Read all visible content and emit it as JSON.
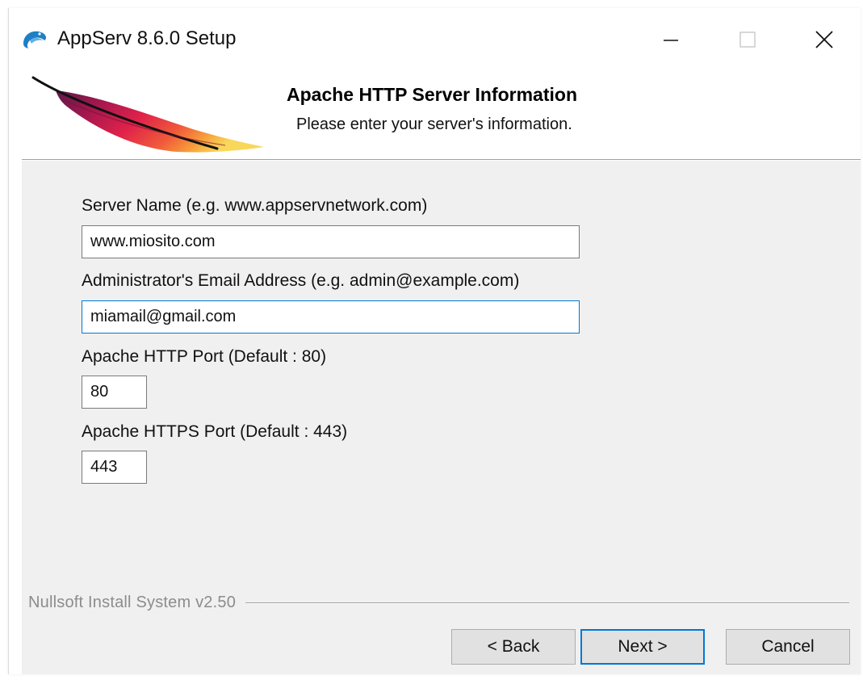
{
  "window": {
    "title": "AppServ 8.6.0 Setup",
    "controls": [
      "minimize-icon",
      "maximize-icon",
      "close-icon"
    ]
  },
  "header": {
    "title": "Apache HTTP Server Information",
    "subtitle": "Please enter your server's information.",
    "logo_icon": "apache-feather-icon"
  },
  "form": {
    "server_name": {
      "label": "Server Name (e.g. www.appservnetwork.com)",
      "value": "www.miosito.com"
    },
    "admin_email": {
      "label": "Administrator's Email Address (e.g. admin@example.com)",
      "value": "miamail@gmail.com"
    },
    "http_port": {
      "label": "Apache HTTP Port (Default : 80)",
      "value": "80"
    },
    "https_port": {
      "label": "Apache HTTPS Port (Default : 443)",
      "value": "443"
    }
  },
  "footer": {
    "branding": "Nullsoft Install System v2.50",
    "back_label": "< Back",
    "next_label": "Next >",
    "cancel_label": "Cancel"
  },
  "colors": {
    "accent": "#0078d7",
    "body_background": "#f0f0f0",
    "button_background": "#e1e1e1"
  }
}
